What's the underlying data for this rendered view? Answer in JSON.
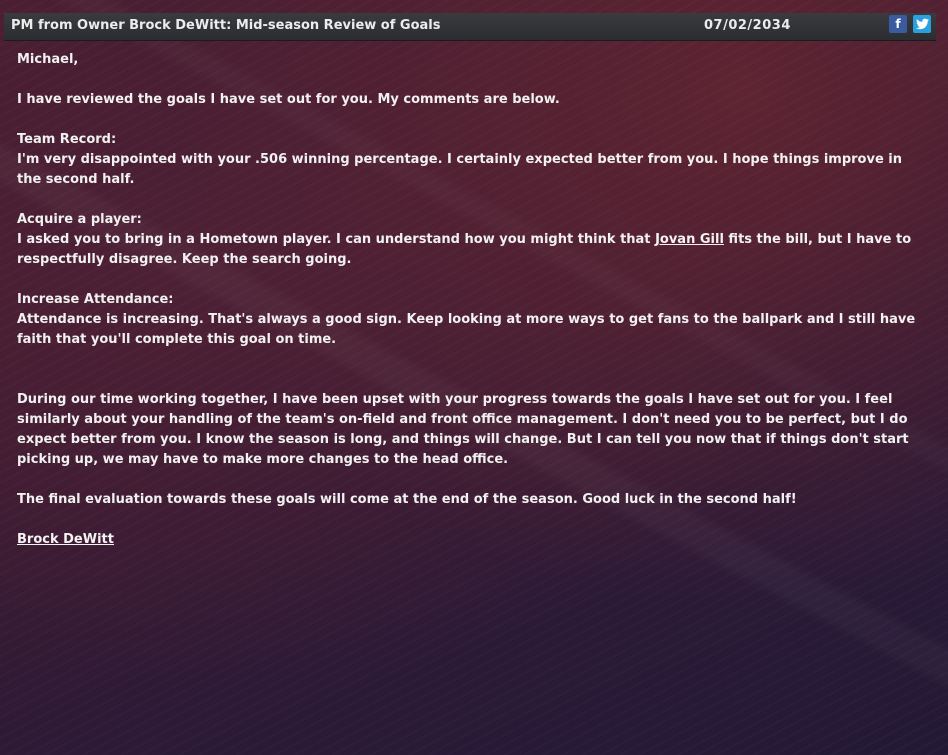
{
  "header": {
    "title": "PM from Owner Brock DeWitt: Mid-season Review of Goals",
    "date": "07/02/2034",
    "facebook_label": "f",
    "twitter_icon": "twitter-bird-icon"
  },
  "message": {
    "greeting": "Michael,",
    "intro": "I have reviewed the goals I have set out for you.  My comments are below.",
    "team_record": {
      "heading": "Team Record:",
      "body": "I'm very disappointed with your .506 winning percentage. I certainly expected better from you. I hope things improve in the second half."
    },
    "acquire": {
      "heading": "Acquire a player:",
      "body_before": "I asked you to bring in a Hometown player. I can understand how you might think that ",
      "player_link": "Jovan Gill",
      "body_after": " fits the bill, but I have to respectfully disagree. Keep the search going."
    },
    "attendance": {
      "heading": "Increase Attendance:",
      "body": "Attendance is increasing. That's always a good sign. Keep looking at more ways to get fans to the ballpark and I still have faith that you'll complete this goal on time."
    },
    "summary": "During our time working together, I have been upset with your progress towards the goals I have set out for you. I feel similarly about your handling of the team's on-field and front office management.  I don't need you to be perfect, but I do expect better from you. I know the season is long, and things will change.  But I can tell you now that if things don't start picking up, we may have to make more changes to the head office.",
    "closing": "The final evaluation towards these goals will come at the end of the season.  Good luck in the second half!",
    "signature": "Brock DeWitt"
  }
}
